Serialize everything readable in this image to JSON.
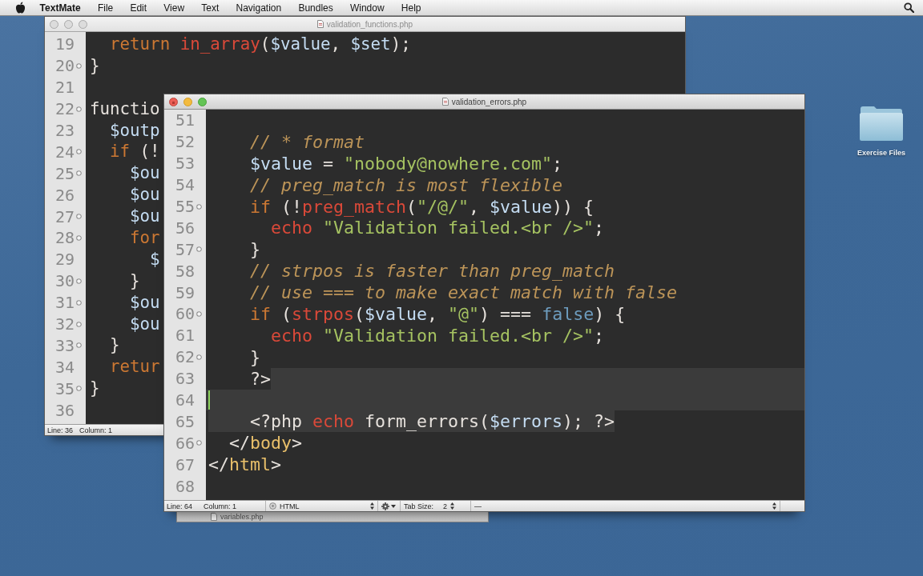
{
  "menu_bar": {
    "app_name": "TextMate",
    "menus": [
      "File",
      "Edit",
      "View",
      "Text",
      "Navigation",
      "Bundles",
      "Window",
      "Help"
    ]
  },
  "windows": [
    {
      "title": "validation_functions.php",
      "active": false,
      "lines": [
        {
          "number": "19",
          "fold": false,
          "tokens": [
            {
              "kind": "keyword",
              "text": "  return"
            },
            {
              "kind": "function",
              "text": " in_array"
            },
            {
              "kind": "plain",
              "text": "("
            },
            {
              "kind": "variable",
              "text": "$value"
            },
            {
              "kind": "plain",
              "text": ", "
            },
            {
              "kind": "variable",
              "text": "$set"
            },
            {
              "kind": "plain",
              "text": ");"
            }
          ]
        },
        {
          "number": "20",
          "fold": true,
          "tokens": [
            {
              "kind": "plain",
              "text": "}"
            }
          ]
        },
        {
          "number": "21",
          "fold": false
        },
        {
          "number": "22",
          "fold": true,
          "tokens": [
            {
              "kind": "plain",
              "text": "functio"
            }
          ]
        },
        {
          "number": "23",
          "fold": false,
          "tokens": [
            {
              "kind": "variable",
              "text": "  $outp"
            }
          ]
        },
        {
          "number": "24",
          "fold": true,
          "tokens": [
            {
              "kind": "keyword",
              "text": "  if"
            },
            {
              "kind": "plain",
              "text": " (!"
            }
          ]
        },
        {
          "number": "25",
          "fold": true,
          "tokens": [
            {
              "kind": "variable",
              "text": "    $ou"
            }
          ]
        },
        {
          "number": "26",
          "fold": false,
          "tokens": [
            {
              "kind": "variable",
              "text": "    $ou"
            }
          ]
        },
        {
          "number": "27",
          "fold": true,
          "tokens": [
            {
              "kind": "variable",
              "text": "    $ou"
            }
          ]
        },
        {
          "number": "28",
          "fold": true,
          "tokens": [
            {
              "kind": "keyword",
              "text": "    for"
            }
          ]
        },
        {
          "number": "29",
          "fold": false,
          "tokens": [
            {
              "kind": "variable",
              "text": "      $"
            }
          ]
        },
        {
          "number": "30",
          "fold": true,
          "tokens": [
            {
              "kind": "plain",
              "text": "    }"
            }
          ]
        },
        {
          "number": "31",
          "fold": true,
          "tokens": [
            {
              "kind": "variable",
              "text": "    $ou"
            }
          ]
        },
        {
          "number": "32",
          "fold": true,
          "tokens": [
            {
              "kind": "variable",
              "text": "    $ou"
            }
          ]
        },
        {
          "number": "33",
          "fold": true,
          "tokens": [
            {
              "kind": "plain",
              "text": "  }"
            }
          ]
        },
        {
          "number": "34",
          "fold": false,
          "tokens": [
            {
              "kind": "keyword",
              "text": "  retur"
            }
          ]
        },
        {
          "number": "35",
          "fold": true,
          "tokens": [
            {
              "kind": "plain",
              "text": "}"
            }
          ]
        },
        {
          "number": "36",
          "fold": false
        }
      ],
      "status_bar": {
        "line": "Line: 36",
        "column": "Column: 1"
      }
    },
    {
      "title": "validation_errors.php",
      "active": true,
      "lines": [
        {
          "number": "51",
          "kind": "normal",
          "fold": false,
          "cursor": false
        },
        {
          "number": "52",
          "kind": "normal",
          "fold": false,
          "cursor": false,
          "tokens": [
            {
              "kind": "comment",
              "text": "    // * format"
            }
          ]
        },
        {
          "number": "53",
          "kind": "normal",
          "fold": false,
          "cursor": false,
          "tokens": [
            {
              "kind": "variable",
              "text": "    $value"
            },
            {
              "kind": "plain",
              "text": " = "
            },
            {
              "kind": "string",
              "text": "\"nobody@nowhere.com\""
            },
            {
              "kind": "plain",
              "text": ";"
            }
          ]
        },
        {
          "number": "54",
          "kind": "normal",
          "fold": false,
          "cursor": false,
          "tokens": [
            {
              "kind": "comment",
              "text": "    // preg_match is most flexible"
            }
          ]
        },
        {
          "number": "55",
          "kind": "normal",
          "fold": true,
          "cursor": false,
          "tokens": [
            {
              "kind": "keyword",
              "text": "    if"
            },
            {
              "kind": "plain",
              "text": " (!"
            },
            {
              "kind": "function",
              "text": "preg_match"
            },
            {
              "kind": "plain",
              "text": "("
            },
            {
              "kind": "string",
              "text": "\"/@/\""
            },
            {
              "kind": "plain",
              "text": ", "
            },
            {
              "kind": "variable",
              "text": "$value"
            },
            {
              "kind": "plain",
              "text": ")) {"
            }
          ]
        },
        {
          "number": "56",
          "kind": "normal",
          "fold": false,
          "cursor": false,
          "tokens": [
            {
              "kind": "function",
              "text": "      echo"
            },
            {
              "kind": "string",
              "text": " \"Validation failed.<br />\""
            },
            {
              "kind": "plain",
              "text": ";"
            }
          ]
        },
        {
          "number": "57",
          "kind": "normal",
          "fold": true,
          "cursor": false,
          "tokens": [
            {
              "kind": "plain",
              "text": "    }"
            }
          ]
        },
        {
          "number": "58",
          "kind": "normal",
          "fold": false,
          "cursor": false,
          "tokens": [
            {
              "kind": "comment",
              "text": "    // strpos is faster than preg_match"
            }
          ]
        },
        {
          "number": "59",
          "kind": "normal",
          "fold": false,
          "cursor": false,
          "tokens": [
            {
              "kind": "comment",
              "text": "    // use === to make exact match with false"
            }
          ]
        },
        {
          "number": "60",
          "kind": "normal",
          "fold": true,
          "cursor": false,
          "tokens": [
            {
              "kind": "keyword",
              "text": "    if"
            },
            {
              "kind": "plain",
              "text": " ("
            },
            {
              "kind": "function",
              "text": "strpos"
            },
            {
              "kind": "plain",
              "text": "("
            },
            {
              "kind": "variable",
              "text": "$value"
            },
            {
              "kind": "plain",
              "text": ", "
            },
            {
              "kind": "string",
              "text": "\"@\""
            },
            {
              "kind": "plain",
              "text": ") === "
            },
            {
              "kind": "constant",
              "text": "false"
            },
            {
              "kind": "plain",
              "text": ") {"
            }
          ]
        },
        {
          "number": "61",
          "kind": "normal",
          "fold": false,
          "cursor": false,
          "tokens": [
            {
              "kind": "function",
              "text": "      echo"
            },
            {
              "kind": "string",
              "text": " \"Validation failed.<br />\""
            },
            {
              "kind": "plain",
              "text": ";"
            }
          ]
        },
        {
          "number": "62",
          "kind": "normal",
          "fold": true,
          "cursor": false,
          "tokens": [
            {
              "kind": "plain",
              "text": "    }"
            }
          ]
        },
        {
          "number": "63",
          "kind": "shade_after",
          "fold": false,
          "cursor": false,
          "tokens": [
            {
              "kind": "plain",
              "text": "    ?>"
            }
          ]
        },
        {
          "number": "64",
          "kind": "shade_full",
          "fold": false,
          "cursor": true
        },
        {
          "number": "65",
          "kind": "shade_text",
          "fold": false,
          "cursor": false,
          "tokens": [
            {
              "kind": "plain",
              "text": "    <?php"
            },
            {
              "kind": "function",
              "text": " echo"
            },
            {
              "kind": "plain",
              "text": " form_errors("
            },
            {
              "kind": "variable",
              "text": "$errors"
            },
            {
              "kind": "plain",
              "text": "); ?>"
            }
          ]
        },
        {
          "number": "66",
          "kind": "normal",
          "fold": true,
          "cursor": false,
          "tokens": [
            {
              "kind": "plain",
              "text": "  </"
            },
            {
              "kind": "tag",
              "text": "body"
            },
            {
              "kind": "plain",
              "text": ">"
            }
          ]
        },
        {
          "number": "67",
          "kind": "normal",
          "fold": false,
          "cursor": false,
          "tokens": [
            {
              "kind": "plain",
              "text": "</"
            },
            {
              "kind": "tag",
              "text": "html"
            },
            {
              "kind": "plain",
              "text": ">"
            }
          ]
        },
        {
          "number": "68",
          "kind": "normal",
          "fold": false,
          "cursor": false
        }
      ],
      "status_bar": {
        "line": "Line: 64",
        "column": "Column: 1",
        "language": "HTML",
        "tab_size_label": "Tab Size:",
        "tab_size": "2",
        "symbol": "—"
      }
    }
  ],
  "background_window": {
    "title": "variables.php"
  },
  "desktop_icons": [
    {
      "label": "Exercise Files"
    }
  ]
}
